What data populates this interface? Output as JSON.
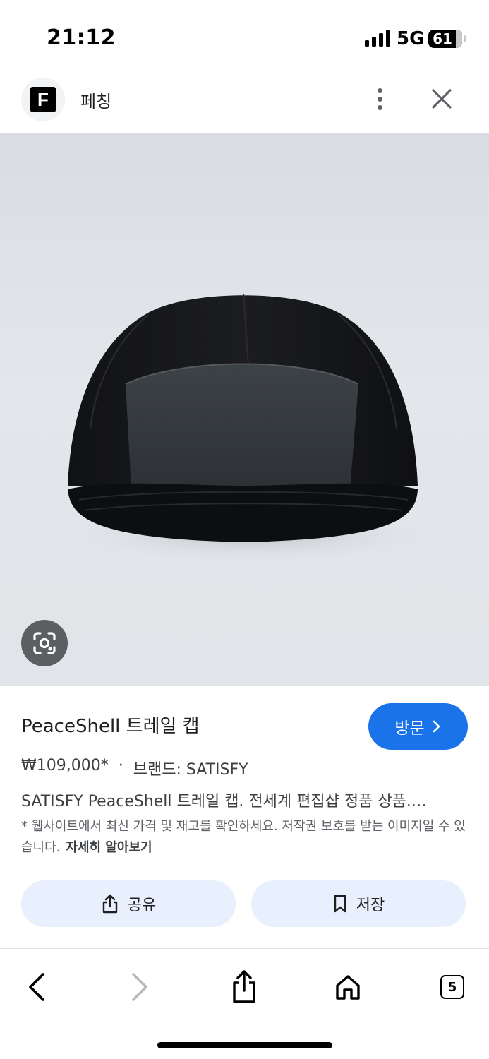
{
  "status_bar": {
    "time": "21:12",
    "network": "5G",
    "battery": "61"
  },
  "header": {
    "site_logo_letter": "F",
    "site_name": "페칭"
  },
  "product": {
    "title": "PeaceShell 트레일 캡",
    "price": "₩109,000*",
    "separator": "·",
    "brand": "브랜드: SATISFY",
    "description": "SATISFY PeaceShell 트레일 캡. 전세계 편집샵 정품 상품.…",
    "disclaimer": "* 웹사이트에서 최신 가격 및 재고를 확인하세요. 저작권 보호를 받는 이미지일 수 있습니다.",
    "learn_more": "자세히 알아보기",
    "visit_label": "방문"
  },
  "actions": {
    "share_label": "공유",
    "save_label": "저장"
  },
  "toolbar": {
    "tabs_count": "5"
  },
  "colors": {
    "accent": "#1a73e8",
    "action_bg": "#e8f0fe"
  }
}
